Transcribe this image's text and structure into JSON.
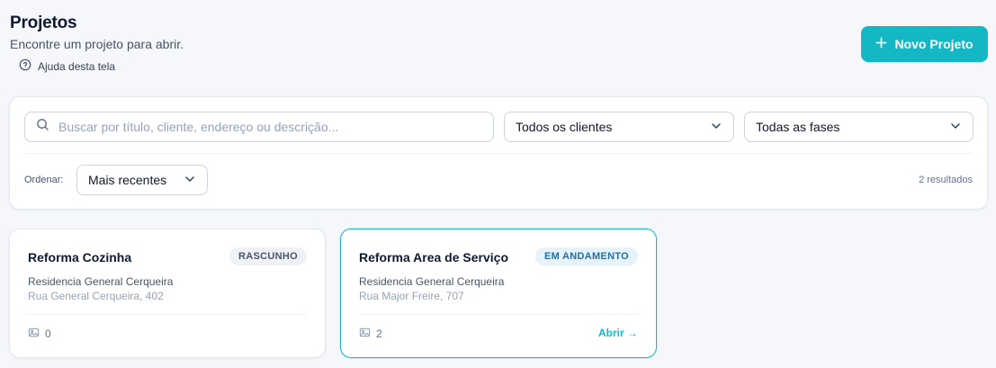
{
  "header": {
    "title": "Projetos",
    "subtitle": "Encontre um projeto para abrir.",
    "help_label": "Ajuda desta tela",
    "new_project_label": "Novo Projeto"
  },
  "filters": {
    "search_placeholder": "Buscar por título, cliente, endereço ou descrição...",
    "search_value": "",
    "client_select": "Todos os clientes",
    "phase_select": "Todas as fases",
    "sort_label": "Ordenar:",
    "sort_select": "Mais recentes",
    "results_count": "2 resultados"
  },
  "projects": [
    {
      "title": "Reforma Cozinha",
      "status": "RASCUNHO",
      "client": "Residencia General Cerqueira",
      "address": "Rua General Cerqueira, 402",
      "photos": "0",
      "open_label": ""
    },
    {
      "title": "Reforma Area de Serviço",
      "status": "EM ANDAMENTO",
      "client": "Residencia General Cerqueira",
      "address": "Rua Major Freire, 707",
      "photos": "2",
      "open_label": "Abrir →"
    }
  ],
  "colors": {
    "accent": "#14b8c4",
    "badge_progress_text": "#1f6fa3",
    "badge_progress_bg": "#e6f3fb",
    "badge_draft_bg": "#eef1f5"
  },
  "icons": {
    "help": "help-circle-icon",
    "plus": "plus-icon",
    "search": "search-icon",
    "chevron": "chevron-down-icon",
    "image": "image-icon"
  }
}
